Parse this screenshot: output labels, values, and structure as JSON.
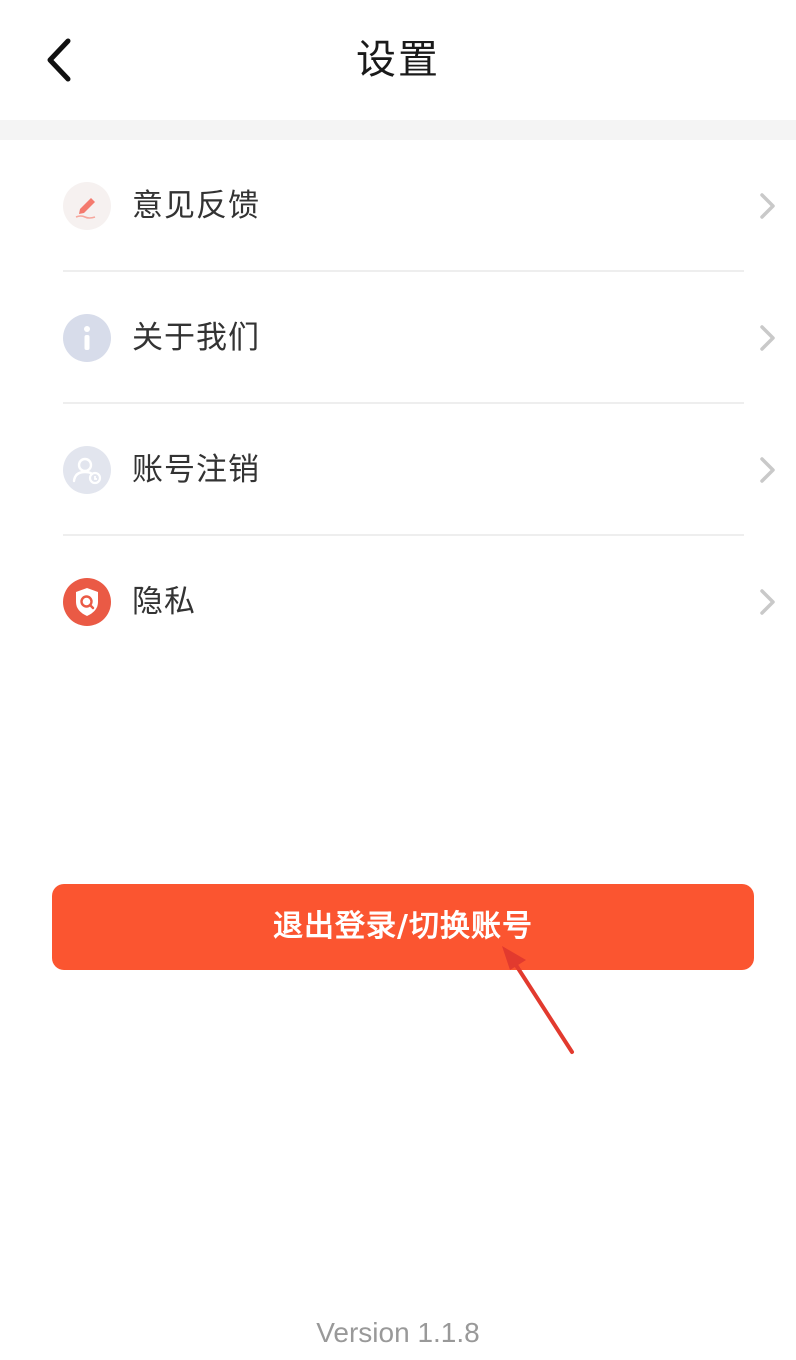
{
  "header": {
    "title": "设置",
    "back_icon": "chevron-left-icon"
  },
  "menu": {
    "items": [
      {
        "label": "意见反馈",
        "icon": "feedback-pen-icon",
        "icon_color": "#f47a6e",
        "icon_bg": "#f6f1f0"
      },
      {
        "label": "关于我们",
        "icon": "info-icon",
        "icon_color": "#ffffff",
        "icon_bg": "#d7dcea"
      },
      {
        "label": "账号注销",
        "icon": "user-cancel-icon",
        "icon_color": "#ffffff",
        "icon_bg": "#e2e5ee"
      },
      {
        "label": "隐私",
        "icon": "privacy-shield-icon",
        "icon_color": "#ffffff",
        "icon_bg": "#ea5a45"
      }
    ],
    "chevron_icon": "chevron-right-icon"
  },
  "logout": {
    "label": "退出登录/切换账号",
    "color": "#fb5530"
  },
  "annotation": {
    "icon": "red-arrow-icon",
    "color": "#e23a2e"
  },
  "footer": {
    "version": "Version 1.1.8"
  }
}
